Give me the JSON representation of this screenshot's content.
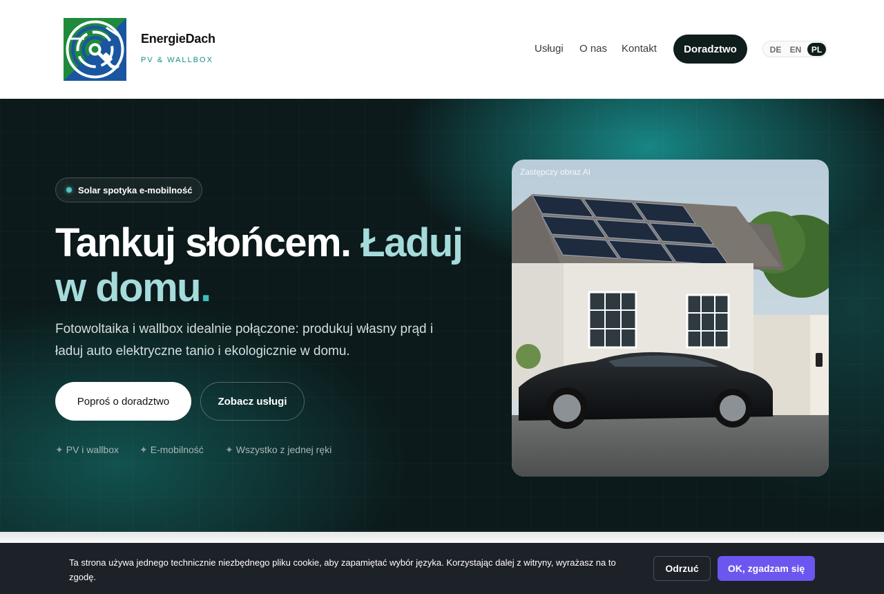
{
  "brand": {
    "name": "EnergieDach",
    "tagline": "PV & WALLBOX",
    "logo_icon": "plug-circuit-logo"
  },
  "nav": {
    "items": [
      {
        "label": "Usługi"
      },
      {
        "label": "O nas"
      },
      {
        "label": "Kontakt"
      }
    ],
    "cta_label": "Doradztwo",
    "languages": [
      {
        "code": "DE",
        "active": false
      },
      {
        "code": "EN",
        "active": false
      },
      {
        "code": "PL",
        "active": true
      }
    ]
  },
  "hero": {
    "badge": "Solar spotyka e-mobilność",
    "headline": {
      "line1": "Tankuj słońcem.",
      "accent1": "Ładuj",
      "accent2": "w domu",
      "period": "."
    },
    "lead": "Fotowoltaika i wallbox idealnie połączone: produkuj własny prąd i ładuj auto elektryczne tanio i ekologicznie w domu.",
    "primary_button": "Poproś o doradztwo",
    "secondary_button": "Zobacz usługi",
    "features": [
      {
        "icon": "sparkle-icon",
        "symbol": "✦",
        "label": "PV i wallbox"
      },
      {
        "icon": "sparkle-icon",
        "symbol": "✦",
        "label": "E-mobilność"
      },
      {
        "icon": "sparkle-icon",
        "symbol": "✦",
        "label": "Wszystko z jednej ręki"
      }
    ],
    "image_caption": "Zastępczy obraz AI"
  },
  "cookie": {
    "text": "Ta strona używa jednego technicznie niezbędnego pliku cookie, aby zapamiętać wybór języka. Korzystając dalej z witryny, wyrażasz na to zgodę.",
    "reject_label": "Odrzuć",
    "accept_label": "OK, zgadzam się"
  },
  "colors": {
    "brand_teal": "#138f8f",
    "hero_background": "#0c1a1b",
    "accent_text": "#a6dbdb",
    "cta_dark": "#0f1e1d",
    "cookie_background": "#1d2128",
    "accept_purple": "#6c56f0"
  }
}
